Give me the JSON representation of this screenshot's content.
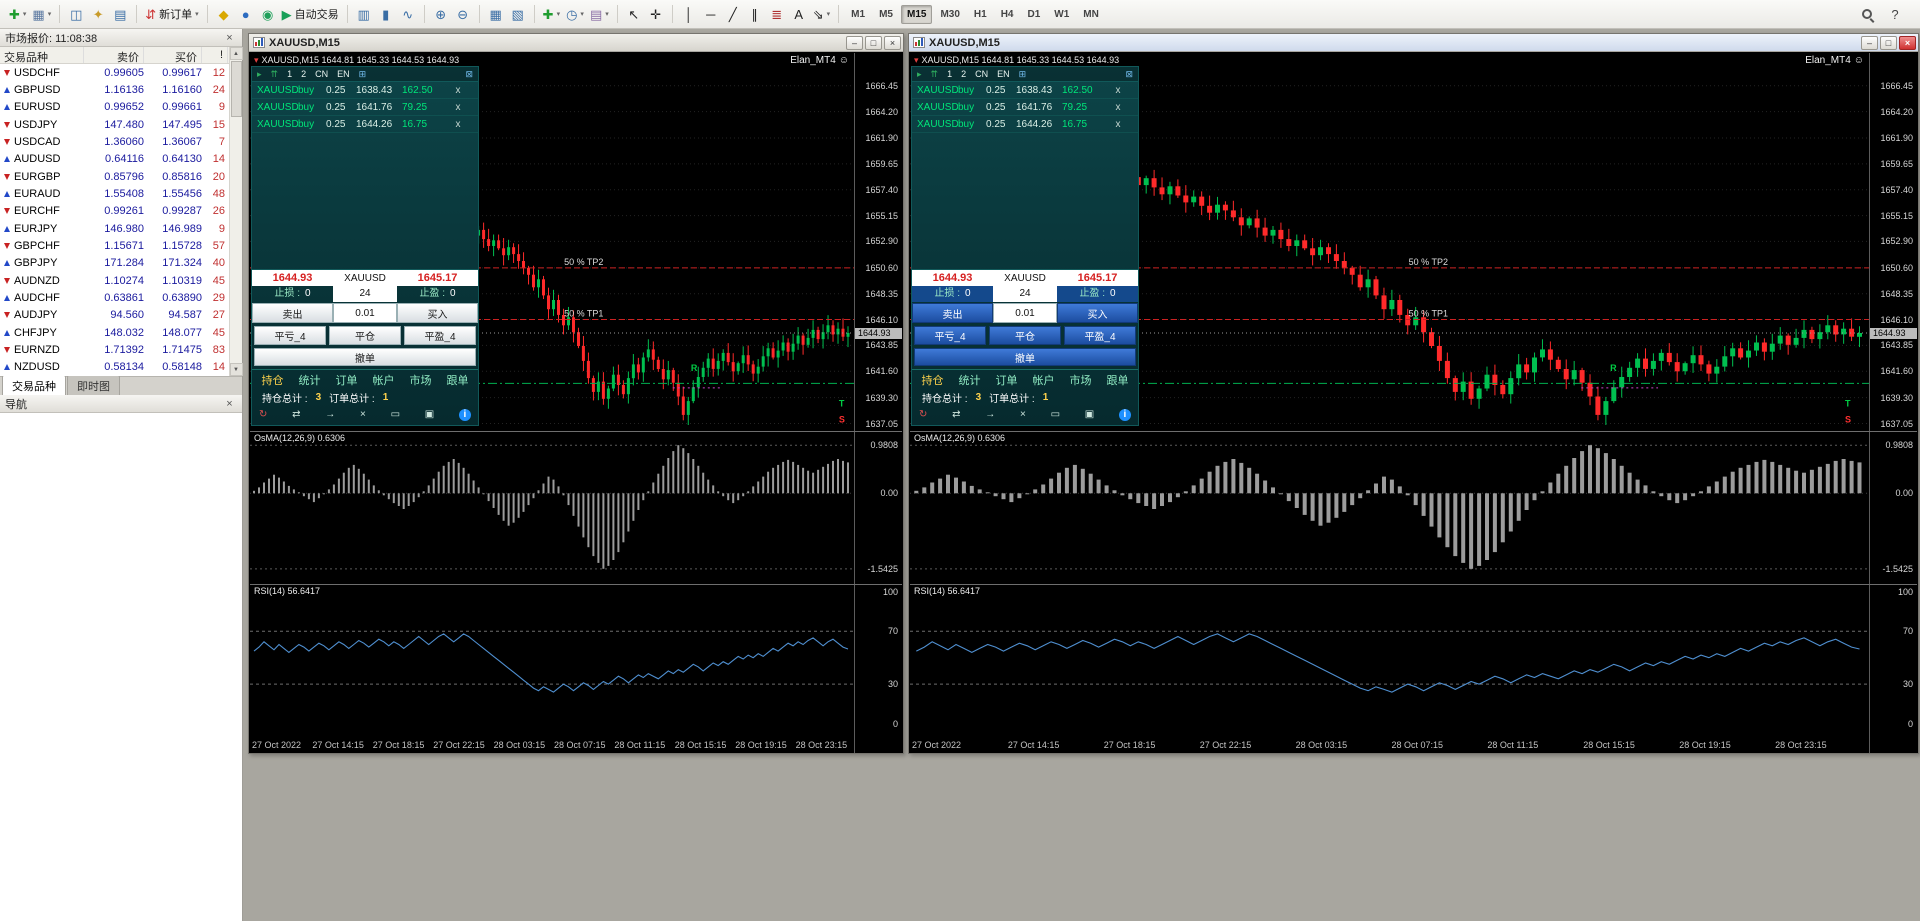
{
  "icons": {
    "minimize": "–",
    "maximize": "□",
    "close": "×",
    "caret_down": "▾",
    "scroll_up": "▲",
    "scroll_down": "▼",
    "smiley": "☺"
  },
  "toolbar": {
    "groups": [
      {
        "name": "chart-profile",
        "items": [
          {
            "name": "new-chart",
            "glyph": "✚",
            "color": "#1f9d2f",
            "caret": true
          },
          {
            "name": "profiles",
            "glyph": "▦",
            "color": "#5a78a0",
            "caret": true
          }
        ]
      },
      {
        "name": "panels",
        "items": [
          {
            "name": "market-watch",
            "glyph": "◫",
            "color": "#3a6ea5"
          },
          {
            "name": "navigator",
            "glyph": "✦",
            "color": "#c89b2a"
          },
          {
            "name": "terminal",
            "glyph": "▤",
            "color": "#3a6ea5"
          }
        ]
      },
      {
        "name": "trade",
        "items": [
          {
            "name": "new-order",
            "glyph": "⇵",
            "color": "#cc3333",
            "label": "新订单",
            "caret": true
          }
        ]
      },
      {
        "name": "tools",
        "items": [
          {
            "name": "metaeditor",
            "glyph": "◆",
            "color": "#d9a800"
          },
          {
            "name": "style-manager",
            "glyph": "●",
            "color": "#2d6cc0"
          },
          {
            "name": "community",
            "glyph": "◉",
            "color": "#1fa05a"
          },
          {
            "name": "autotrading",
            "glyph": "▶",
            "color": "#18a058",
            "label": "自动交易"
          }
        ]
      },
      {
        "name": "chart-type",
        "items": [
          {
            "name": "bar-chart",
            "glyph": "▥",
            "color": "#3a6ea5"
          },
          {
            "name": "candlestick-chart",
            "glyph": "▮",
            "color": "#3a6ea5"
          },
          {
            "name": "line-chart",
            "glyph": "∿",
            "color": "#3a6ea5"
          }
        ]
      },
      {
        "name": "zoom",
        "items": [
          {
            "name": "zoom-in",
            "glyph": "⊕",
            "color": "#3a6ea5"
          },
          {
            "name": "zoom-out",
            "glyph": "⊖",
            "color": "#3a6ea5"
          }
        ]
      },
      {
        "name": "windows",
        "items": [
          {
            "name": "tile-windows",
            "glyph": "▦",
            "color": "#3a6ea5"
          },
          {
            "name": "cascade-windows",
            "glyph": "▧",
            "color": "#3a6ea5"
          }
        ]
      },
      {
        "name": "chart-tools",
        "items": [
          {
            "name": "indicators",
            "glyph": "✚",
            "color": "#1f9d2f",
            "caret": true
          },
          {
            "name": "periods",
            "glyph": "◷",
            "color": "#3a6ea5",
            "caret": true
          },
          {
            "name": "templates",
            "glyph": "▤",
            "color": "#8a6ea5",
            "caret": true
          }
        ]
      },
      {
        "name": "cursor",
        "items": [
          {
            "name": "cursor",
            "glyph": "↖",
            "color": "#222222"
          },
          {
            "name": "crosshair",
            "glyph": "✛",
            "color": "#222222"
          }
        ]
      },
      {
        "name": "objects",
        "items": [
          {
            "name": "vertical-line",
            "glyph": "│",
            "color": "#222222"
          },
          {
            "name": "horizontal-line",
            "glyph": "─",
            "color": "#222222"
          },
          {
            "name": "trendline",
            "glyph": "╱",
            "color": "#222222"
          },
          {
            "name": "equidistant-channel",
            "glyph": "∥",
            "color": "#222222"
          },
          {
            "name": "fibonacci",
            "glyph": "≣",
            "color": "#b03030"
          },
          {
            "name": "text",
            "glyph": "A",
            "color": "#222222"
          },
          {
            "name": "arrows",
            "glyph": "⇘",
            "color": "#222222",
            "caret": true
          }
        ]
      }
    ],
    "periods": [
      {
        "label": "M1"
      },
      {
        "label": "M5"
      },
      {
        "label": "M15",
        "active": true
      },
      {
        "label": "M30"
      },
      {
        "label": "H1"
      },
      {
        "label": "H4"
      },
      {
        "label": "D1"
      },
      {
        "label": "W1"
      },
      {
        "label": "MN"
      }
    ],
    "right_items": [
      {
        "name": "search",
        "glyph": ""
      },
      {
        "name": "help",
        "glyph": "?",
        "color": "#444444"
      }
    ]
  },
  "market_watch": {
    "title": "市场报价: 11:08:38",
    "columns": [
      "交易品种",
      "卖价",
      "买价",
      "!"
    ],
    "tabs": [
      {
        "label": "交易品种",
        "active": true
      },
      {
        "label": "即时图",
        "active": false
      }
    ],
    "rows": [
      {
        "symbol": "USDCHF",
        "bid": "0.99605",
        "ask": "0.99617",
        "spread": "12",
        "dir": "down"
      },
      {
        "symbol": "GBPUSD",
        "bid": "1.16136",
        "ask": "1.16160",
        "spread": "24",
        "dir": "up"
      },
      {
        "symbol": "EURUSD",
        "bid": "0.99652",
        "ask": "0.99661",
        "spread": "9",
        "dir": "up"
      },
      {
        "symbol": "USDJPY",
        "bid": "147.480",
        "ask": "147.495",
        "spread": "15",
        "dir": "down"
      },
      {
        "symbol": "USDCAD",
        "bid": "1.36060",
        "ask": "1.36067",
        "spread": "7",
        "dir": "down"
      },
      {
        "symbol": "AUDUSD",
        "bid": "0.64116",
        "ask": "0.64130",
        "spread": "14",
        "dir": "up"
      },
      {
        "symbol": "EURGBP",
        "bid": "0.85796",
        "ask": "0.85816",
        "spread": "20",
        "dir": "down"
      },
      {
        "symbol": "EURAUD",
        "bid": "1.55408",
        "ask": "1.55456",
        "spread": "48",
        "dir": "up"
      },
      {
        "symbol": "EURCHF",
        "bid": "0.99261",
        "ask": "0.99287",
        "spread": "26",
        "dir": "down"
      },
      {
        "symbol": "EURJPY",
        "bid": "146.980",
        "ask": "146.989",
        "spread": "9",
        "dir": "up"
      },
      {
        "symbol": "GBPCHF",
        "bid": "1.15671",
        "ask": "1.15728",
        "spread": "57",
        "dir": "down"
      },
      {
        "symbol": "GBPJPY",
        "bid": "171.284",
        "ask": "171.324",
        "spread": "40",
        "dir": "up"
      },
      {
        "symbol": "AUDNZD",
        "bid": "1.10274",
        "ask": "1.10319",
        "spread": "45",
        "dir": "down"
      },
      {
        "symbol": "AUDCHF",
        "bid": "0.63861",
        "ask": "0.63890",
        "spread": "29",
        "dir": "up"
      },
      {
        "symbol": "AUDJPY",
        "bid": "94.560",
        "ask": "94.587",
        "spread": "27",
        "dir": "down"
      },
      {
        "symbol": "CHFJPY",
        "bid": "148.032",
        "ask": "148.077",
        "spread": "45",
        "dir": "up"
      },
      {
        "symbol": "EURNZD",
        "bid": "1.71392",
        "ask": "1.71475",
        "spread": "83",
        "dir": "down"
      },
      {
        "symbol": "NZDUSD",
        "bid": "0.58134",
        "ask": "0.58148",
        "spread": "14",
        "dir": "up"
      }
    ]
  },
  "navigator": {
    "title": "导航"
  },
  "ea_panel": {
    "mini_toolbar": [
      {
        "name": "run",
        "glyph": "▸",
        "color": "#2fae5f"
      },
      {
        "name": "arrows-up",
        "glyph": "⇈",
        "color": "#2fae5f"
      },
      {
        "name": "layout-1",
        "glyph": "1",
        "color": "#e8f4f0"
      },
      {
        "name": "layout-2",
        "glyph": "2",
        "color": "#e8f4f0"
      },
      {
        "name": "lang-cn",
        "glyph": "CN",
        "color": "#e8f4f0"
      },
      {
        "name": "lang-en",
        "glyph": "EN",
        "color": "#e8f4f0"
      },
      {
        "name": "grid",
        "glyph": "⊞",
        "color": "#70b8e8"
      },
      {
        "name": "collapse",
        "glyph": "⊠",
        "color": "#70b8e8"
      }
    ],
    "positions": [
      {
        "symbol": "XAUUSD",
        "side": "buy",
        "lots": "0.25",
        "open": "1638.43",
        "profit": "162.50",
        "close": "x"
      },
      {
        "symbol": "XAUUSD",
        "side": "buy",
        "lots": "0.25",
        "open": "1641.76",
        "profit": "79.25",
        "close": "x"
      },
      {
        "symbol": "XAUUSD",
        "side": "buy",
        "lots": "0.25",
        "open": "1644.26",
        "profit": "16.75",
        "close": "x"
      }
    ],
    "bid": "1644.93",
    "symbol": "XAUUSD",
    "ask": "1645.17",
    "sl_label": "止损 :",
    "sl_value": "0",
    "spread": "24",
    "tp_label": "止盈 :",
    "tp_value": "0",
    "sell_label": "卖出",
    "lots": "0.01",
    "buy_label": "买入",
    "close_loss_label": "平亏_4",
    "close_all_label": "平仓",
    "close_profit_label": "平盈_4",
    "cancel_label": "撤单",
    "tabs": [
      {
        "label": "持仓",
        "active": true
      },
      {
        "label": "统计"
      },
      {
        "label": "订单"
      },
      {
        "label": "帐户"
      },
      {
        "label": "市场"
      },
      {
        "label": "跟单"
      }
    ],
    "totals": [
      {
        "label": "持仓总计 :",
        "value": "3"
      },
      {
        "label": "订单总计 :",
        "value": "1"
      }
    ],
    "footer_icons": [
      {
        "name": "refresh",
        "glyph": "↻",
        "color": "#e05050"
      },
      {
        "name": "swap",
        "glyph": "⇄",
        "color": "#cfe8e0"
      },
      {
        "name": "forward",
        "glyph": "→",
        "color": "#cfe8e0"
      },
      {
        "name": "close-all",
        "glyph": "×",
        "color": "#cfe8e0"
      },
      {
        "name": "panel",
        "glyph": "▭",
        "color": "#cfe8e0"
      },
      {
        "name": "copy",
        "glyph": "▣",
        "color": "#cfe8e0"
      },
      {
        "name": "info",
        "glyph": "i",
        "color": "#ffffff",
        "circle": "#1e90ff"
      }
    ]
  },
  "charts": [
    {
      "title": "XAUUSD,M15",
      "active": false,
      "panel_theme": "light"
    },
    {
      "title": "XAUUSD,M15",
      "active": true,
      "panel_theme": "blue"
    }
  ],
  "chart_shared": {
    "ohlc_header": "XAUUSD,M15  1644.81 1645.33 1644.53 1644.93",
    "watermark": "Elan_MT4",
    "price_axis": [
      "1666.45",
      "1664.20",
      "1661.90",
      "1659.65",
      "1657.40",
      "1655.15",
      "1652.90",
      "1650.60",
      "1648.35",
      "1646.10",
      "1643.85",
      "1641.60",
      "1639.30",
      "1637.05"
    ],
    "current_price": "1644.93",
    "time_axis": [
      "27 Oct 2022",
      "27 Oct 14:15",
      "27 Oct 18:15",
      "27 Oct 22:15",
      "28 Oct 03:15",
      "28 Oct 07:15",
      "28 Oct 11:15",
      "28 Oct 15:15",
      "28 Oct 19:15",
      "28 Oct 23:15"
    ],
    "osma_label": "OsMA(12,26,9) 0.6306",
    "osma_axis": [
      "0.9808",
      "0.00",
      "-1.5425"
    ],
    "rsi_label": "RSI(14) 56.6417",
    "rsi_axis": [
      "100",
      "70",
      "30",
      "0"
    ]
  },
  "chart_data": {
    "type": "candlestick",
    "symbol": "XAUUSD",
    "timeframe": "M15",
    "note": "both chart windows display the same series",
    "price_range": [
      1636.4,
      1669.3
    ],
    "first_open": 1664.5,
    "colors": {
      "up": "#00c050",
      "down": "#ff2a2a",
      "osma": "#9c9c9c",
      "rsi": "#4f8fd0"
    },
    "closes": [
      1665.0,
      1665.8,
      1666.2,
      1665.6,
      1664.9,
      1665.3,
      1664.2,
      1663.0,
      1663.6,
      1662.8,
      1662.2,
      1661.5,
      1662.0,
      1661.2,
      1660.4,
      1660.9,
      1660.2,
      1659.6,
      1660.3,
      1659.8,
      1659.2,
      1658.7,
      1659.4,
      1658.8,
      1658.2,
      1658.6,
      1659.3,
      1658.5,
      1657.8,
      1658.4,
      1657.6,
      1657.0,
      1657.7,
      1656.9,
      1656.3,
      1656.8,
      1656.0,
      1655.4,
      1656.1,
      1655.6,
      1655.0,
      1654.3,
      1654.9,
      1654.1,
      1653.4,
      1653.9,
      1653.1,
      1652.5,
      1653.0,
      1652.3,
      1651.7,
      1652.4,
      1651.8,
      1651.2,
      1650.6,
      1650.0,
      1648.9,
      1649.6,
      1648.2,
      1647.0,
      1647.8,
      1646.5,
      1645.6,
      1646.3,
      1645.0,
      1643.8,
      1642.5,
      1641.0,
      1639.8,
      1640.7,
      1639.2,
      1640.1,
      1641.3,
      1640.4,
      1639.6,
      1641.0,
      1642.2,
      1641.5,
      1642.8,
      1643.5,
      1642.6,
      1641.8,
      1640.9,
      1641.7,
      1640.6,
      1639.4,
      1637.8,
      1639.0,
      1640.2,
      1641.1,
      1641.9,
      1642.7,
      1641.8,
      1642.5,
      1643.2,
      1642.4,
      1641.6,
      1642.3,
      1643.0,
      1642.2,
      1641.4,
      1642.0,
      1642.9,
      1643.6,
      1642.8,
      1643.4,
      1644.1,
      1643.3,
      1644.0,
      1644.7,
      1643.9,
      1644.5,
      1645.2,
      1644.4,
      1645.0,
      1645.6,
      1644.8,
      1645.3,
      1644.6,
      1644.93
    ],
    "levels": [
      {
        "price": 1650.6,
        "label": "50   %   TP2",
        "color": "#cc2222",
        "style": "dash"
      },
      {
        "price": 1646.1,
        "label": "50   %   TP1",
        "color": "#cc2222",
        "style": "dash"
      },
      {
        "price": 1644.93,
        "label": "",
        "color": "#9a9a9a",
        "style": "dot"
      },
      {
        "price": 1640.55,
        "label": "",
        "color": "#00b050",
        "style": "dashdot"
      }
    ],
    "segments": [
      {
        "x1_frac": 0.7,
        "x2_frac": 0.78,
        "price": 1640.15,
        "color": "#cc44cc"
      }
    ],
    "markers": [
      {
        "text": "R",
        "color": "#00cc44",
        "x_frac": 0.73,
        "price": 1641.9
      },
      {
        "text": "T",
        "color": "#00cc44",
        "x_frac": 0.975,
        "price": 1638.8
      },
      {
        "text": "S",
        "color": "#ff3030",
        "x_frac": 0.975,
        "price": 1637.4
      }
    ],
    "osma": {
      "levels": [
        0.9808,
        -1.5425
      ],
      "values": [
        0.05,
        0.12,
        0.22,
        0.3,
        0.38,
        0.32,
        0.24,
        0.15,
        0.08,
        0.02,
        -0.06,
        -0.12,
        -0.18,
        -0.1,
        -0.02,
        0.08,
        0.18,
        0.3,
        0.42,
        0.52,
        0.58,
        0.5,
        0.4,
        0.28,
        0.16,
        0.06,
        -0.04,
        -0.12,
        -0.2,
        -0.26,
        -0.32,
        -0.26,
        -0.18,
        -0.08,
        0.04,
        0.16,
        0.3,
        0.44,
        0.56,
        0.64,
        0.7,
        0.62,
        0.52,
        0.4,
        0.26,
        0.12,
        -0.02,
        -0.16,
        -0.3,
        -0.44,
        -0.56,
        -0.66,
        -0.6,
        -0.5,
        -0.38,
        -0.24,
        -0.1,
        0.06,
        0.2,
        0.34,
        0.28,
        0.14,
        -0.04,
        -0.24,
        -0.46,
        -0.68,
        -0.9,
        -1.1,
        -1.28,
        -1.42,
        -1.54,
        -1.48,
        -1.36,
        -1.2,
        -1.0,
        -0.78,
        -0.56,
        -0.34,
        -0.14,
        0.04,
        0.22,
        0.4,
        0.56,
        0.72,
        0.86,
        0.98,
        0.92,
        0.82,
        0.7,
        0.56,
        0.42,
        0.28,
        0.16,
        0.04,
        -0.06,
        -0.14,
        -0.2,
        -0.14,
        -0.06,
        0.04,
        0.14,
        0.24,
        0.34,
        0.44,
        0.52,
        0.58,
        0.64,
        0.68,
        0.64,
        0.58,
        0.52,
        0.46,
        0.42,
        0.48,
        0.54,
        0.6,
        0.66,
        0.7,
        0.66,
        0.63
      ]
    },
    "rsi": {
      "levels": [
        70,
        30
      ],
      "values": [
        55,
        58,
        62,
        59,
        56,
        60,
        57,
        54,
        57,
        60,
        58,
        55,
        58,
        61,
        59,
        56,
        59,
        62,
        60,
        57,
        60,
        63,
        61,
        58,
        61,
        64,
        62,
        59,
        62,
        60,
        57,
        60,
        63,
        66,
        63,
        60,
        63,
        66,
        68,
        65,
        62,
        65,
        68,
        66,
        63,
        60,
        57,
        54,
        51,
        48,
        45,
        42,
        39,
        36,
        33,
        30,
        27,
        25,
        28,
        26,
        24,
        27,
        30,
        28,
        25,
        28,
        31,
        29,
        26,
        29,
        32,
        30,
        33,
        36,
        34,
        31,
        34,
        37,
        35,
        38,
        36,
        34,
        37,
        40,
        38,
        41,
        39,
        42,
        45,
        43,
        40,
        43,
        46,
        44,
        47,
        45,
        48,
        51,
        49,
        52,
        50,
        53,
        51,
        54,
        57,
        55,
        58,
        61,
        59,
        62,
        60,
        63,
        65,
        62,
        59,
        62,
        64,
        61,
        58,
        56.6
      ]
    }
  }
}
